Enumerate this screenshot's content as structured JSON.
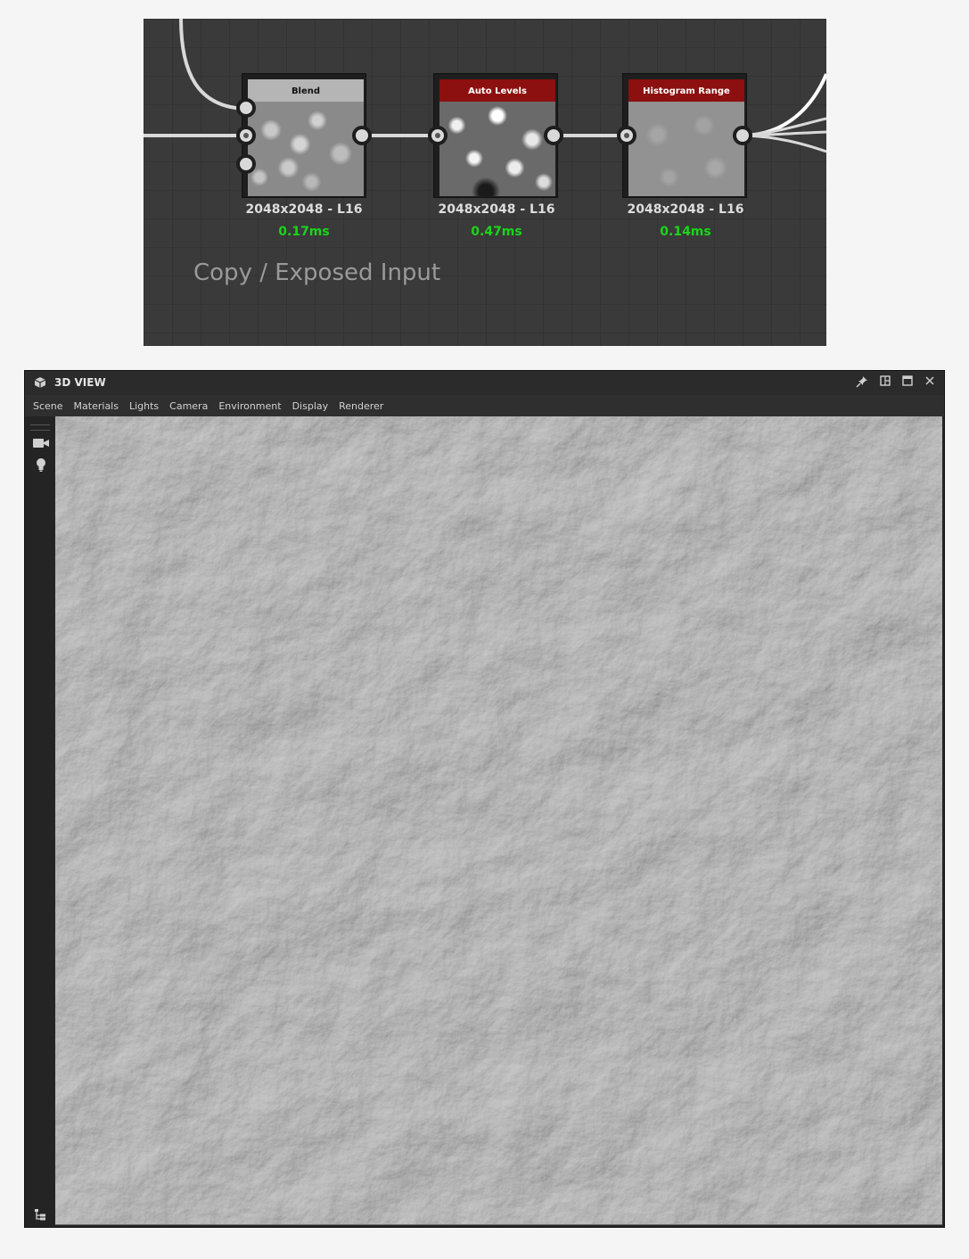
{
  "graph": {
    "nodes": [
      {
        "title": "Blend",
        "info": "2048x2048 - L16",
        "time": "0.17ms"
      },
      {
        "title": "Auto Levels",
        "info": "2048x2048 - L16",
        "time": "0.47ms"
      },
      {
        "title": "Histogram Range",
        "info": "2048x2048 - L16",
        "time": "0.14ms"
      }
    ],
    "frame_label": "Copy / Exposed Input"
  },
  "view3d": {
    "title": "3D VIEW",
    "menu": [
      "Scene",
      "Materials",
      "Lights",
      "Camera",
      "Environment",
      "Display",
      "Renderer"
    ],
    "icons": {
      "title": "cube-icon",
      "pin": "pin-icon",
      "layout": "layout-icon",
      "maximize": "maximize-icon",
      "close": "close-icon",
      "camera": "camera-icon",
      "light": "lightbulb-icon",
      "outliner": "hierarchy-icon"
    },
    "surface": "rock heightmap render"
  }
}
